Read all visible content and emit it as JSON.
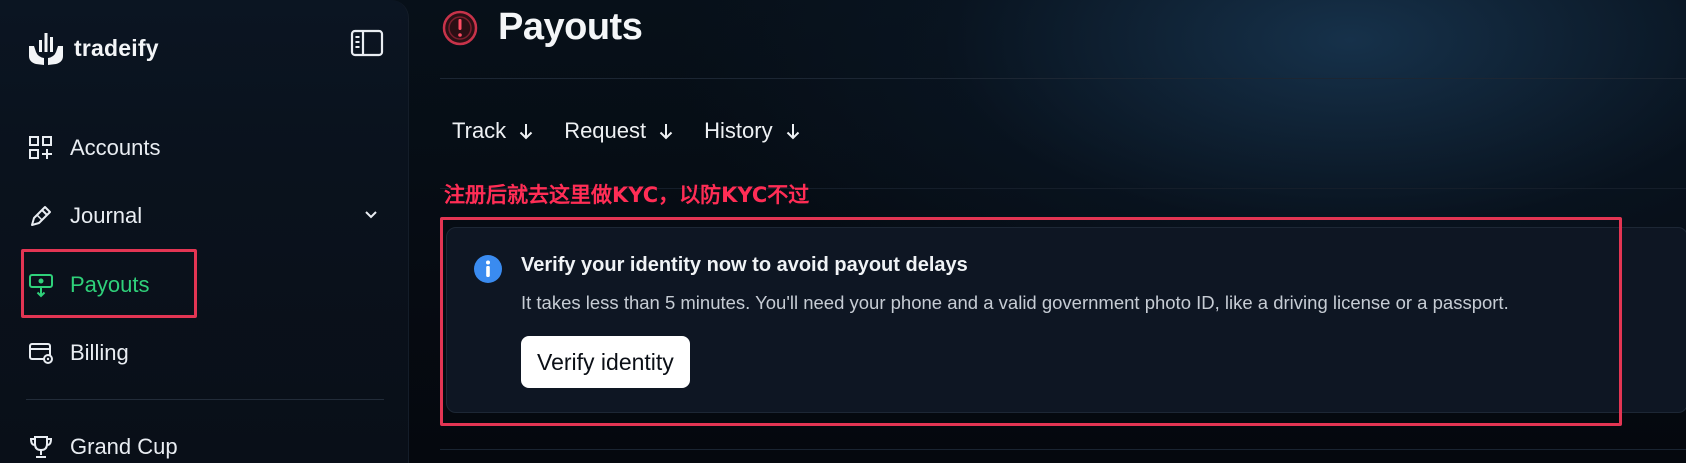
{
  "brand": {
    "name": "tradeify"
  },
  "sidebar": {
    "items": [
      {
        "label": "Accounts",
        "icon": "grid-plus-icon"
      },
      {
        "label": "Journal",
        "icon": "pen-icon"
      },
      {
        "label": "Payouts",
        "icon": "cash-download-icon",
        "active": true
      },
      {
        "label": "Billing",
        "icon": "card-gear-icon"
      },
      {
        "label": "Grand Cup",
        "icon": "trophy-icon"
      }
    ]
  },
  "header": {
    "title": "Payouts",
    "status_icon": "warning-circle-icon"
  },
  "tabs": [
    {
      "label": "Track"
    },
    {
      "label": "Request"
    },
    {
      "label": "History"
    }
  ],
  "annotation": {
    "text": "注册后就去这里做KYC，以防KYC不过"
  },
  "alert": {
    "title": "Verify your identity now to avoid payout delays",
    "body": "It takes less than 5 minutes. You'll need your phone and a valid government photo ID, like a driving license or a passport.",
    "button": "Verify identity",
    "icon": "info-icon"
  },
  "colors": {
    "accent_active": "#2fd17a",
    "highlight": "#e33553",
    "annotation": "#ff2d55",
    "info": "#3a8bf0"
  }
}
